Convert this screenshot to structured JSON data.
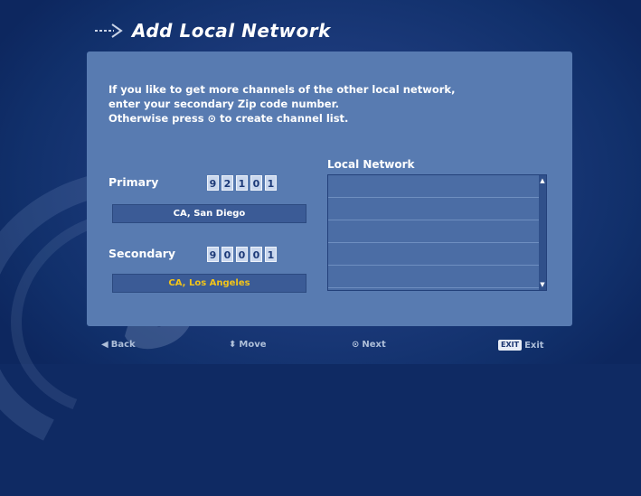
{
  "title": "Add Local Network",
  "info_lines": [
    "If you like to get more channels of the other local network,",
    "enter your secondary Zip code number.",
    "Otherwise press ⊙ to create channel list."
  ],
  "primary": {
    "label": "Primary",
    "digits": [
      "9",
      "2",
      "1",
      "0",
      "1"
    ],
    "location": "CA, San Diego"
  },
  "secondary": {
    "label": "Secondary",
    "digits": [
      "9",
      "0",
      "0",
      "0",
      "1"
    ],
    "location": "CA, Los Angeles"
  },
  "local_network": {
    "title": "Local Network",
    "rows": [
      "",
      "",
      "",
      "",
      ""
    ]
  },
  "footer": {
    "back": "Back",
    "move": "Move",
    "next": "Next",
    "exit_key": "EXIT",
    "exit": "Exit"
  },
  "colors": {
    "panel": "#587bb1",
    "secondary_location_text": "#f2c419"
  },
  "icons": {
    "title": "arrow-right-icon",
    "back": "left-triangle-icon",
    "move": "up-down-icon",
    "next": "ok-circle-icon"
  }
}
